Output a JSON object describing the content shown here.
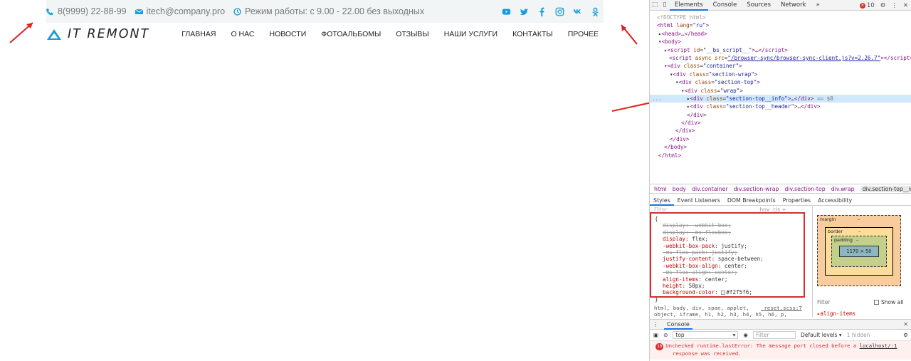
{
  "site": {
    "phone": "8(9999) 22-88-99",
    "email": "itech@company.pro",
    "hours": "Режим работы: с 9.00 - 22.00 без выходных",
    "socials": [
      "youtube-icon",
      "twitter-icon",
      "facebook-icon",
      "instagram-icon",
      "vk-icon",
      "odnoklassniki-icon"
    ],
    "logo_text": "IT REMONT",
    "accent": "#1a9cd8",
    "info_bg": "#f2f5f6",
    "nav": [
      "ГЛАВНАЯ",
      "О НАС",
      "НОВОСТИ",
      "ФОТОАЛЬБОМЫ",
      "ОТЗЫВЫ",
      "НАШИ УСЛУГИ",
      "КОНТАКТЫ",
      "ПРОЧЕЕ"
    ]
  },
  "devtools": {
    "tabs": [
      "Elements",
      "Console",
      "Sources",
      "Network"
    ],
    "more": "»",
    "error_count": "10",
    "dom": {
      "doctype": "<!DOCTYPE html>",
      "html_tag": "html",
      "lang_attr": "lang",
      "lang_val": "\"ru\"",
      "head": "head",
      "body": "body",
      "script1_attr": "id",
      "script1_val": "\"__bs_script__\"",
      "script2_src": "\"/browser-sync/browser-sync-client.js?v=2.26.7\"",
      "async": "async",
      "src": "src",
      "script": "script",
      "div": "div",
      "class": "class",
      "container": "\"container\"",
      "section_wrap": "\"section-wrap\"",
      "section_top": "\"section-top\"",
      "wrap": "\"wrap\"",
      "info": "\"section-top__info\"",
      "header": "\"section-top__header\"",
      "ellipsis": "…",
      "eq": "== $0",
      "dots": "..."
    },
    "breadcrumbs": [
      "html",
      "body",
      "div.container",
      "div.section-wrap",
      "div.section-top",
      "div.wrap",
      "div.section-top__info"
    ],
    "subtabs": [
      "Styles",
      "Event Listeners",
      "DOM Breakpoints",
      "Properties",
      "Accessibility"
    ],
    "filter_placeholder": "Filter",
    "hov_cls": ":hov .cls +",
    "css_rules": [
      {
        "prop": "display",
        "value": "-webkit-box;",
        "strike": true
      },
      {
        "prop": "display",
        "value": "-ms-flexbox;",
        "strike": true
      },
      {
        "prop": "display",
        "value": "flex;",
        "strike": false
      },
      {
        "prop": "-webkit-box-pack",
        "value": "justify;",
        "strike": false
      },
      {
        "prop": "-ms-flex-pack",
        "value": "justify;",
        "strike": true
      },
      {
        "prop": "justify-content",
        "value": "space-between;",
        "strike": false
      },
      {
        "prop": "-webkit-box-align",
        "value": "center;",
        "strike": false
      },
      {
        "prop": "-ms-flex-align",
        "value": "center;",
        "strike": true
      },
      {
        "prop": "align-items",
        "value": "center;",
        "strike": false
      },
      {
        "prop": "height",
        "value": "50px;",
        "strike": false
      },
      {
        "prop": "background-color",
        "value": "#f2f5f6;",
        "strike": false,
        "swatch": true
      }
    ],
    "css_open": "{",
    "css_close": "}",
    "reset_rule_line1": "html, body, div, span, applet,",
    "reset_rule_line2": "object, iframe, h1, h2, h3, h4, h5, h6, p,",
    "reset_source": "_reset.scss:7",
    "box_model": {
      "margin": "margin",
      "border": "border",
      "padding": "padding",
      "content": "1170 × 50",
      "dash": "–"
    },
    "filter_label": "Filter",
    "show_all": "Show all",
    "align_items": "align-items",
    "console": {
      "title": "Console",
      "context": "top",
      "filter": "Filter",
      "levels": "Default levels ▾",
      "hidden": "1 hidden",
      "error_badge": "10",
      "error_text": "Unchecked runtime.lastError: The message port closed before a",
      "error_text2": "response was received.",
      "error_src": "localhost/:1"
    }
  }
}
